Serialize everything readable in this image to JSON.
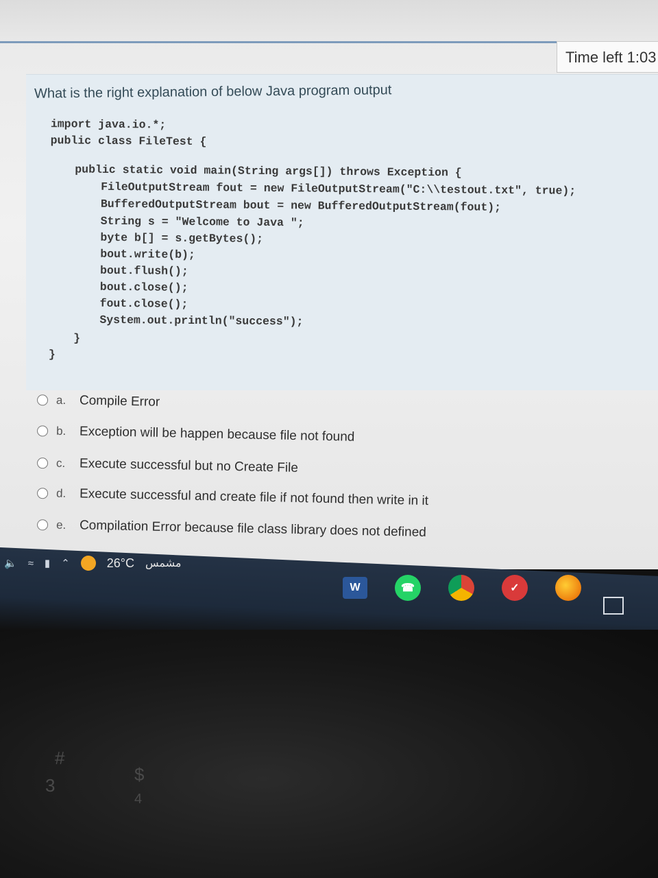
{
  "timer": {
    "label": "Time left 1:03"
  },
  "question": {
    "text": "What is the right explanation of below Java program output",
    "code_lines": [
      "import java.io.*;",
      "public class FileTest {",
      "public static void main(String args[]) throws Exception {",
      "FileOutputStream fout = new FileOutputStream(\"C:\\\\testout.txt\", true);",
      "BufferedOutputStream bout = new BufferedOutputStream(fout);",
      "String s = \"Welcome to Java \";",
      "byte b[] = s.getBytes();",
      "bout.write(b);",
      "bout.flush();",
      "bout.close();",
      "fout.close();",
      "System.out.println(\"success\");",
      "}",
      "}"
    ]
  },
  "answers": [
    {
      "letter": "a.",
      "text": "Compile Error"
    },
    {
      "letter": "b.",
      "text": "Exception will be happen because file not found"
    },
    {
      "letter": "c.",
      "text": "Execute successful but no Create File"
    },
    {
      "letter": "d.",
      "text": "Execute successful and create file if not found then write in it"
    },
    {
      "letter": "e.",
      "text": "Compilation Error because file class library does not defined"
    }
  ],
  "taskbar": {
    "weather": "26°C",
    "weather_desc": "مشمس",
    "apps": [
      "word-icon",
      "whatsapp-icon",
      "chrome-icon",
      "red-app-icon",
      "firefox-icon"
    ],
    "word_letter": "W"
  },
  "keyboard": {
    "glyphs": [
      "#",
      "3",
      "$",
      "4"
    ]
  }
}
